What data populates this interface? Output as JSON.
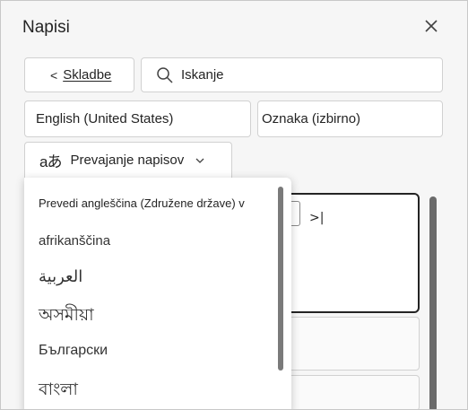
{
  "panel": {
    "title": "Napisi",
    "close_icon": "close-icon"
  },
  "toolbar": {
    "back_arrow": "<",
    "back_label": "Skladbe",
    "search_value": "Iskanje",
    "search_icon": "search-icon"
  },
  "fields": {
    "language": "English (United States)",
    "tag": "Oznaka (izbirno)"
  },
  "translate": {
    "icon": "aあ",
    "label": "Prevajanje napisov",
    "chevron_icon": "chevron-down-icon"
  },
  "editor": {
    "skip_icon": ">|"
  },
  "dropdown": {
    "header": "Prevedi angleščina (Združene države) v",
    "items": [
      "afrikanščina",
      "العربية",
      "অসমীয়া",
      "Български",
      "বাংলা"
    ]
  },
  "colors": {
    "panel_background": "#f6f6f6",
    "border": "#d1d1d1",
    "text": "#242424"
  }
}
